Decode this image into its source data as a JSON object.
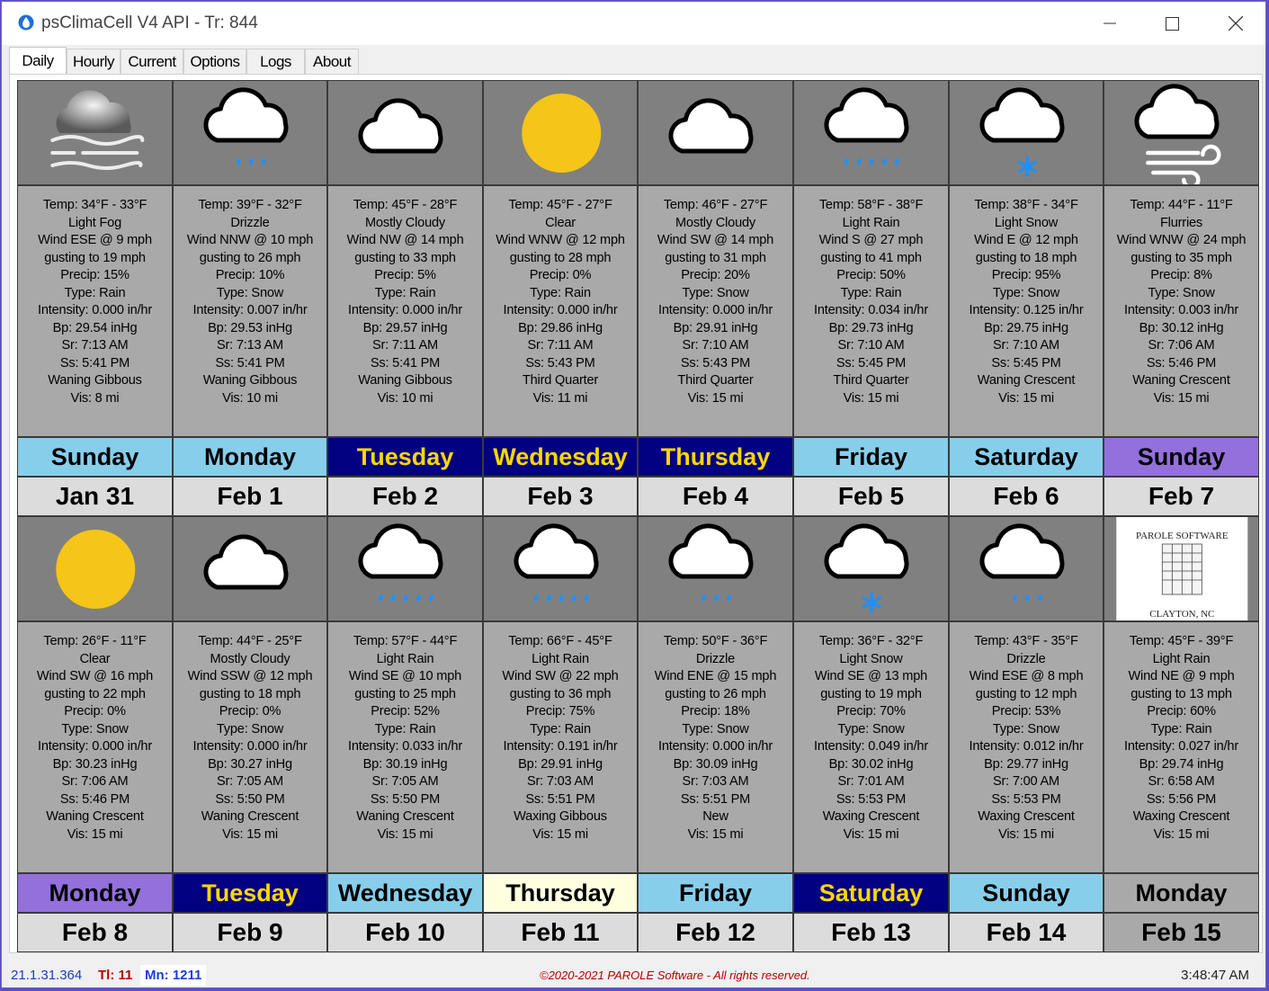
{
  "window": {
    "title": "psClimaCell V4 API - Tr: 844"
  },
  "tabs": [
    {
      "label": "Daily"
    },
    {
      "label": "Hourly"
    },
    {
      "label": "Current"
    },
    {
      "label": "Options"
    },
    {
      "label": "Logs"
    },
    {
      "label": "About"
    }
  ],
  "days": [
    {
      "icon": "fog-icon",
      "lines": [
        "Temp: 34°F - 33°F",
        "Light Fog",
        "Wind ESE @ 9 mph",
        "gusting to 19 mph",
        "Precip: 15%",
        "Type: Rain",
        "Intensity: 0.000 in/hr",
        "Bp: 29.54 inHg",
        "Sr: 7:13 AM",
        "Ss: 5:41 PM",
        "Waning Gibbous",
        "Vis: 8 mi"
      ],
      "day": "Sunday",
      "date": "Jan 31",
      "day_bg": "#87ceeb",
      "day_fg": "#000000"
    },
    {
      "icon": "drizzle-icon",
      "lines": [
        "Temp: 39°F - 32°F",
        "Drizzle",
        "Wind NNW @ 10 mph",
        "gusting to 26 mph",
        "Precip: 10%",
        "Type: Snow",
        "Intensity: 0.007 in/hr",
        "Bp: 29.53 inHg",
        "Sr: 7:13 AM",
        "Ss: 5:41 PM",
        "Waning Gibbous",
        "Vis: 10 mi"
      ],
      "day": "Monday",
      "date": "Feb 1",
      "day_bg": "#87ceeb",
      "day_fg": "#000000"
    },
    {
      "icon": "cloud-icon",
      "lines": [
        "Temp: 45°F - 28°F",
        "Mostly Cloudy",
        "Wind NW @ 14 mph",
        "gusting to 33 mph",
        "Precip: 5%",
        "Type: Rain",
        "Intensity: 0.000 in/hr",
        "Bp: 29.57 inHg",
        "Sr: 7:11 AM",
        "Ss: 5:41 PM",
        "Waning Gibbous",
        "Vis: 10 mi"
      ],
      "day": "Tuesday",
      "date": "Feb 2",
      "day_bg": "#000080",
      "day_fg": "#ffd700"
    },
    {
      "icon": "sun-icon",
      "lines": [
        "Temp: 45°F - 27°F",
        "Clear",
        "Wind WNW @ 12 mph",
        "gusting to 28 mph",
        "Precip: 0%",
        "Type: Rain",
        "Intensity: 0.000 in/hr",
        "Bp: 29.86 inHg",
        "Sr: 7:11 AM",
        "Ss: 5:43 PM",
        "Third Quarter",
        "Vis: 11 mi"
      ],
      "day": "Wednesday",
      "date": "Feb 3",
      "day_bg": "#000080",
      "day_fg": "#ffd700"
    },
    {
      "icon": "cloud-icon",
      "lines": [
        "Temp: 46°F - 27°F",
        "Mostly Cloudy",
        "Wind SW @ 14 mph",
        "gusting to 31 mph",
        "Precip: 20%",
        "Type: Snow",
        "Intensity: 0.000 in/hr",
        "Bp: 29.91 inHg",
        "Sr: 7:10 AM",
        "Ss: 5:43 PM",
        "Third Quarter",
        "Vis: 15 mi"
      ],
      "day": "Thursday",
      "date": "Feb 4",
      "day_bg": "#000080",
      "day_fg": "#ffd700"
    },
    {
      "icon": "rain-icon",
      "lines": [
        "Temp: 58°F - 38°F",
        "Light Rain",
        "Wind S @ 27 mph",
        "gusting to 41 mph",
        "Precip: 50%",
        "Type: Rain",
        "Intensity: 0.034 in/hr",
        "Bp: 29.73 inHg",
        "Sr: 7:10 AM",
        "Ss: 5:45 PM",
        "Third Quarter",
        "Vis: 15 mi"
      ],
      "day": "Friday",
      "date": "Feb 5",
      "day_bg": "#87ceeb",
      "day_fg": "#000000"
    },
    {
      "icon": "snow-icon",
      "lines": [
        "Temp: 38°F - 34°F",
        "Light Snow",
        "Wind E @ 12 mph",
        "gusting to 18 mph",
        "Precip: 95%",
        "Type: Snow",
        "Intensity: 0.125 in/hr",
        "Bp: 29.75 inHg",
        "Sr: 7:10 AM",
        "Ss: 5:45 PM",
        "Waning Crescent",
        "Vis: 15 mi"
      ],
      "day": "Saturday",
      "date": "Feb 6",
      "day_bg": "#87ceeb",
      "day_fg": "#000000"
    },
    {
      "icon": "wind-icon",
      "lines": [
        "Temp: 44°F - 11°F",
        "Flurries",
        "Wind WNW @ 24 mph",
        "gusting to 35 mph",
        "Precip: 8%",
        "Type: Snow",
        "Intensity: 0.003 in/hr",
        "Bp: 30.12 inHg",
        "Sr: 7:06 AM",
        "Ss: 5:46 PM",
        "Waning Crescent",
        "Vis: 15 mi"
      ],
      "day": "Sunday",
      "date": "Feb 7",
      "day_bg": "#9370db",
      "day_fg": "#000000"
    },
    {
      "icon": "sun-icon",
      "lines": [
        "Temp: 26°F - 11°F",
        "Clear",
        "Wind SW @ 16 mph",
        "gusting to 22 mph",
        "Precip: 0%",
        "Type: Snow",
        "Intensity: 0.000 in/hr",
        "Bp: 30.23 inHg",
        "Sr: 7:06 AM",
        "Ss: 5:46 PM",
        "Waning Crescent",
        "Vis: 15 mi"
      ],
      "day": "Monday",
      "date": "Feb 8",
      "day_bg": "#9370db",
      "day_fg": "#000000"
    },
    {
      "icon": "cloud-icon",
      "lines": [
        "Temp: 44°F - 25°F",
        "Mostly Cloudy",
        "Wind SSW @ 12 mph",
        "gusting to 18 mph",
        "Precip: 0%",
        "Type: Snow",
        "Intensity: 0.000 in/hr",
        "Bp: 30.27 inHg",
        "Sr: 7:05 AM",
        "Ss: 5:50 PM",
        "Waning Crescent",
        "Vis: 15 mi"
      ],
      "day": "Tuesday",
      "date": "Feb 9",
      "day_bg": "#000080",
      "day_fg": "#ffd700"
    },
    {
      "icon": "rain-icon",
      "lines": [
        "Temp: 57°F - 44°F",
        "Light Rain",
        "Wind SE @ 10 mph",
        "gusting to 25 mph",
        "Precip: 52%",
        "Type: Rain",
        "Intensity: 0.033 in/hr",
        "Bp: 30.19 inHg",
        "Sr: 7:05 AM",
        "Ss: 5:50 PM",
        "Waning Crescent",
        "Vis: 15 mi"
      ],
      "day": "Wednesday",
      "date": "Feb 10",
      "day_bg": "#87ceeb",
      "day_fg": "#000000"
    },
    {
      "icon": "rain-icon",
      "lines": [
        "Temp: 66°F - 45°F",
        "Light Rain",
        "Wind SW @ 22 mph",
        "gusting to 36 mph",
        "Precip: 75%",
        "Type: Rain",
        "Intensity: 0.191 in/hr",
        "Bp: 29.91 inHg",
        "Sr: 7:03 AM",
        "Ss: 5:51 PM",
        "Waxing Gibbous",
        "Vis: 15 mi"
      ],
      "day": "Thursday",
      "date": "Feb 11",
      "day_bg": "#ffffe0",
      "day_fg": "#000000"
    },
    {
      "icon": "drizzle-icon",
      "lines": [
        "Temp: 50°F - 36°F",
        "Drizzle",
        "Wind ENE @ 15 mph",
        "gusting to 26 mph",
        "Precip: 18%",
        "Type: Snow",
        "Intensity: 0.000 in/hr",
        "Bp: 30.09 inHg",
        "Sr: 7:03 AM",
        "Ss: 5:51 PM",
        "New",
        "Vis: 15 mi"
      ],
      "day": "Friday",
      "date": "Feb 12",
      "day_bg": "#87ceeb",
      "day_fg": "#000000"
    },
    {
      "icon": "snow-icon",
      "lines": [
        "Temp: 36°F - 32°F",
        "Light Snow",
        "Wind SE @ 13 mph",
        "gusting to 19 mph",
        "Precip: 70%",
        "Type: Snow",
        "Intensity: 0.049 in/hr",
        "Bp: 30.02 inHg",
        "Sr: 7:01 AM",
        "Ss: 5:53 PM",
        "Waxing Crescent",
        "Vis: 15 mi"
      ],
      "day": "Saturday",
      "date": "Feb 13",
      "day_bg": "#000080",
      "day_fg": "#ffd700"
    },
    {
      "icon": "drizzle-icon",
      "lines": [
        "Temp: 43°F - 35°F",
        "Drizzle",
        "Wind ESE @ 8 mph",
        "gusting to 12 mph",
        "Precip: 53%",
        "Type: Snow",
        "Intensity: 0.012 in/hr",
        "Bp: 29.77 inHg",
        "Sr: 7:00 AM",
        "Ss: 5:53 PM",
        "Waxing Crescent",
        "Vis: 15 mi"
      ],
      "day": "Sunday",
      "date": "Feb 14",
      "day_bg": "#87ceeb",
      "day_fg": "#000000"
    },
    {
      "icon": "parole-logo",
      "logo_top": "PAROLE SOFTWARE",
      "logo_bottom": "CLAYTON, NC",
      "lines": [
        "Temp: 45°F - 39°F",
        "Light Rain",
        "Wind NE @ 9 mph",
        "gusting to 13 mph",
        "Precip: 60%",
        "Type: Rain",
        "Intensity: 0.027 in/hr",
        "Bp: 29.74 inHg",
        "Sr: 6:58 AM",
        "Ss: 5:56 PM",
        "Waxing Crescent",
        "Vis: 15 mi"
      ],
      "day": "Monday",
      "date": "Feb 15",
      "day_bg": "#a9a9a9",
      "day_fg": "#000000",
      "date_bg": "#a9a9a9"
    }
  ],
  "status": {
    "version": "21.1.31.364",
    "tl": "Tl: 11",
    "mn": "Mn: 1211",
    "copyright": "©2020-2021 PAROLE Software - All rights reserved.",
    "time": "3:48:47 AM"
  },
  "colors": {
    "sun": "#f5c518",
    "drop": "#1e90ff",
    "panel": "#808080",
    "info": "#a9a9a9"
  }
}
